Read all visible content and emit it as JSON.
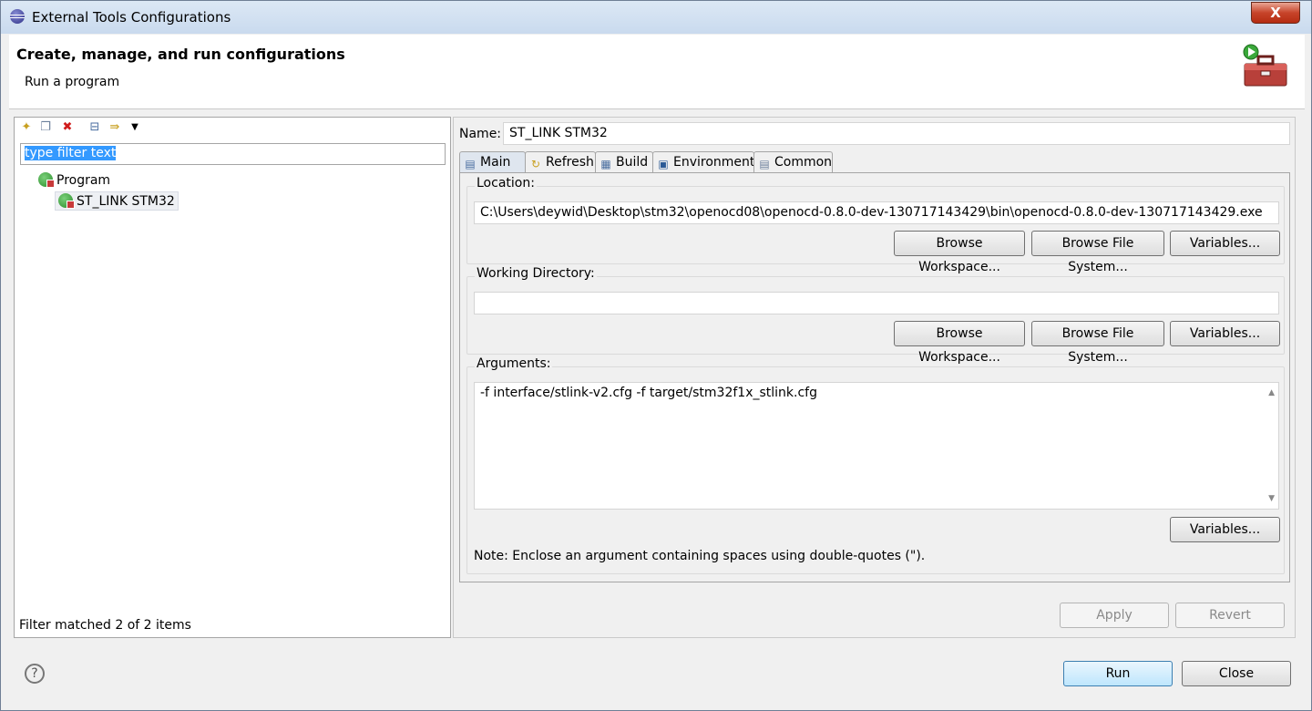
{
  "window": {
    "title": "External Tools Configurations",
    "close_symbol": "X"
  },
  "header": {
    "heading": "Create, manage, and run configurations",
    "subheading": "Run a program",
    "icon": "toolbox-run-icon"
  },
  "left": {
    "toolbar_icons": [
      "new-config-icon",
      "duplicate-icon",
      "delete-icon",
      "collapse-all-icon",
      "filter-icon",
      "view-menu-icon"
    ],
    "filter_placeholder": "type filter text",
    "tree": [
      {
        "label": "Program",
        "level": 1
      },
      {
        "label": "ST_LINK STM32",
        "level": 2,
        "selected": true
      }
    ],
    "status": "Filter matched 2 of 2 items"
  },
  "right": {
    "name_label": "Name:",
    "name_value": "ST_LINK STM32",
    "tabs": [
      {
        "label": "Main",
        "icon": "main-tab-icon",
        "active": true
      },
      {
        "label": "Refresh",
        "icon": "refresh-icon"
      },
      {
        "label": "Build",
        "icon": "build-icon"
      },
      {
        "label": "Environment",
        "icon": "environment-icon"
      },
      {
        "label": "Common",
        "icon": "common-icon"
      }
    ],
    "location": {
      "label": "Location:",
      "value": "C:\\Users\\deywid\\Desktop\\stm32\\openocd08\\openocd-0.8.0-dev-130717143429\\bin\\openocd-0.8.0-dev-130717143429.exe",
      "browse_workspace": "Browse Workspace...",
      "browse_fs": "Browse File System...",
      "variables": "Variables..."
    },
    "working_dir": {
      "label": "Working Directory:",
      "value": "",
      "browse_workspace": "Browse Workspace...",
      "browse_fs": "Browse File System...",
      "variables": "Variables..."
    },
    "arguments": {
      "label": "Arguments:",
      "value": "-f interface/stlink-v2.cfg -f target/stm32f1x_stlink.cfg",
      "variables": "Variables...",
      "note": "Note: Enclose an argument containing spaces using double-quotes (\")."
    },
    "apply": "Apply",
    "revert": "Revert"
  },
  "footer": {
    "help": "?",
    "run": "Run",
    "close": "Close"
  }
}
